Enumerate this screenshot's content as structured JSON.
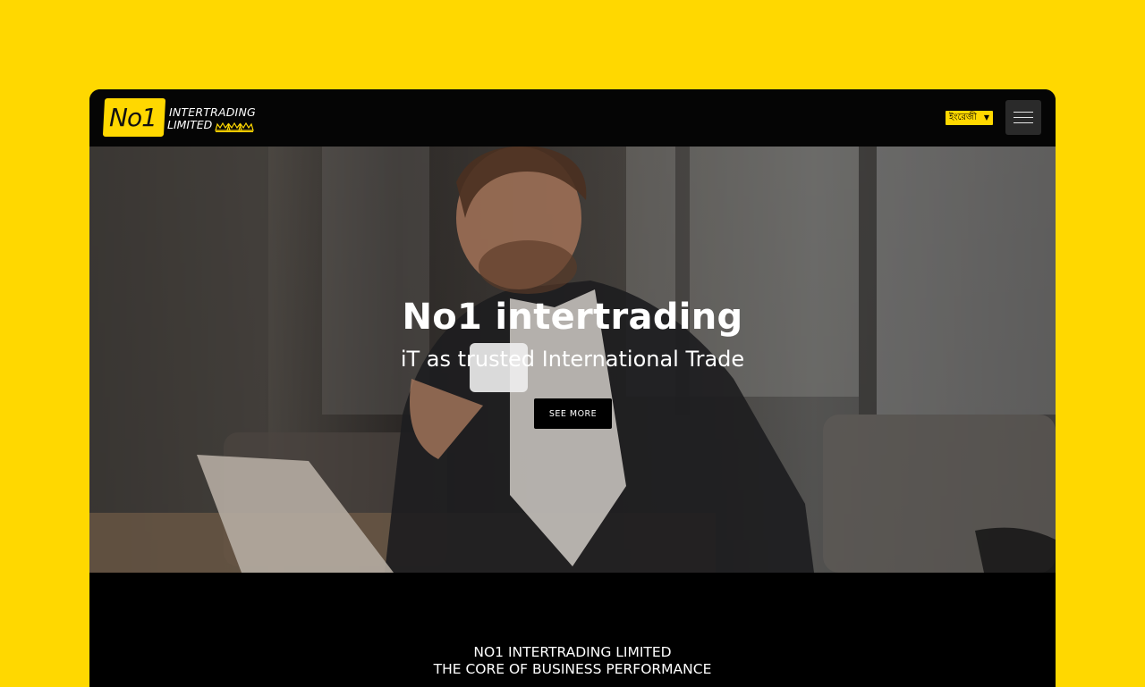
{
  "brand": {
    "logo_mark": "No1",
    "name_line1": "INTERTRADING",
    "name_line2": "LIMITED"
  },
  "header": {
    "language_selected": "ইংরেজী"
  },
  "hero": {
    "title": "No1 intertrading",
    "subtitle": "iT as trusted International Trade",
    "cta_label": "SEE MORE"
  },
  "intro": {
    "line1": "NO1 INTERTRADING LIMITED",
    "line2": "THE CORE OF BUSINESS PERFORMANCE"
  },
  "colors": {
    "accent": "#ffd800",
    "background": "#000000",
    "text": "#ffffff"
  },
  "icons": [
    "crown-icon",
    "chevron-down-icon",
    "hamburger-menu-icon"
  ]
}
